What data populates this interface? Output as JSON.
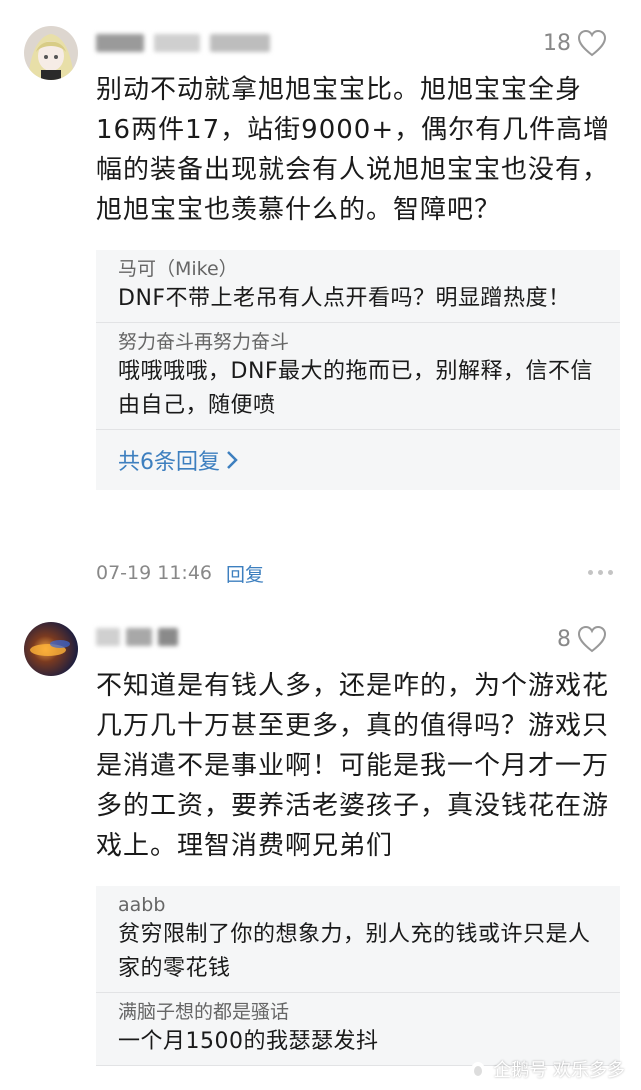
{
  "comments": [
    {
      "likes": "18",
      "text": "别动不动就拿旭旭宝宝比。旭旭宝宝全身16两件17，站街9000+，偶尔有几件高增幅的装备出现就会有人说旭旭宝宝也没有，旭旭宝宝也羡慕什么的。智障吧？",
      "replies": [
        {
          "name": "马可（Mike）",
          "text": "DNF不带上老吊有人点开看吗？明显蹭热度！"
        },
        {
          "name": "努力奋斗再努力奋斗",
          "text": "哦哦哦哦，DNF最大的拖而已，别解释，信不信由自己，随便喷"
        }
      ],
      "more_replies": "共6条回复",
      "timestamp": "07-19 11:46",
      "reply_label": "回复"
    },
    {
      "likes": "8",
      "text": "不知道是有钱人多，还是咋的，为个游戏花几万几十万甚至更多，真的值得吗？游戏只是消遣不是事业啊！可能是我一个月才一万多的工资，要养活老婆孩子，真没钱花在游戏上。理智消费啊兄弟们",
      "replies": [
        {
          "name": "aabb",
          "text": "贫穷限制了你的想象力，别人充的钱或许只是人家的零花钱"
        },
        {
          "name": "满脑子想的都是骚话",
          "text": "一个月1500的我瑟瑟发抖"
        }
      ]
    }
  ],
  "watermark": "企鹅号 欢乐多多",
  "colors": {
    "link": "#3d7fbf",
    "reply_bg": "#f5f6f7",
    "muted": "#888888"
  }
}
